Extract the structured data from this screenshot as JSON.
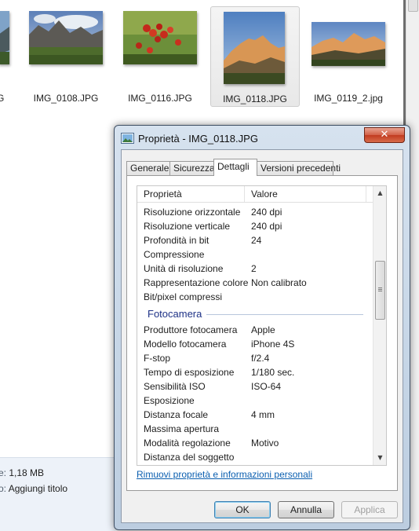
{
  "explorer": {
    "thumbnails": [
      {
        "label": "G",
        "image": "mountain-clouds-photo"
      },
      {
        "label": "IMG_0108.JPG",
        "image": "dolomites-meadow-photo"
      },
      {
        "label": "IMG_0116.JPG",
        "image": "red-berries-photo"
      },
      {
        "label": "IMG_0118.JPG",
        "image": "mountain-sunset-photo"
      },
      {
        "label": "IMG_0119_2.jpg",
        "image": "mountain-sunset-photo-2"
      }
    ],
    "details": {
      "size_label": "e:",
      "size_value": "1,18 MB",
      "title_label": "o:",
      "title_value": "Aggiungi titolo"
    }
  },
  "dialog": {
    "title": "Proprietà - IMG_0118.JPG",
    "close_label": "✕",
    "tabs": [
      "Generale",
      "Sicurezza",
      "Dettagli",
      "Versioni precedenti"
    ],
    "active_tab": "Dettagli",
    "columns": {
      "name": "Proprietà",
      "value": "Valore"
    },
    "rows_a": [
      {
        "name": "Risoluzione orizzontale",
        "value": "240 dpi"
      },
      {
        "name": "Risoluzione verticale",
        "value": "240 dpi"
      },
      {
        "name": "Profondità in bit",
        "value": "24"
      },
      {
        "name": "Compressione",
        "value": ""
      },
      {
        "name": "Unità di risoluzione",
        "value": "2"
      },
      {
        "name": "Rappresentazione colore",
        "value": "Non calibrato"
      },
      {
        "name": "Bit/pixel compressi",
        "value": ""
      }
    ],
    "group_title": "Fotocamera",
    "rows_b": [
      {
        "name": "Produttore fotocamera",
        "value": "Apple"
      },
      {
        "name": "Modello fotocamera",
        "value": "iPhone 4S"
      },
      {
        "name": "F-stop",
        "value": "f/2.4"
      },
      {
        "name": "Tempo di esposizione",
        "value": "1/180 sec."
      },
      {
        "name": "Sensibilità ISO",
        "value": "ISO-64"
      },
      {
        "name": "Esposizione",
        "value": ""
      },
      {
        "name": "Distanza focale",
        "value": "4 mm"
      },
      {
        "name": "Massima apertura",
        "value": ""
      },
      {
        "name": "Modalità regolazione",
        "value": "Motivo"
      },
      {
        "name": "Distanza del soggetto",
        "value": ""
      }
    ],
    "remove_link": "Rimuovi proprietà e informazioni personali",
    "buttons": {
      "ok": "OK",
      "cancel": "Annulla",
      "apply": "Applica"
    },
    "scroll_up": "▲",
    "scroll_down": "▼"
  }
}
